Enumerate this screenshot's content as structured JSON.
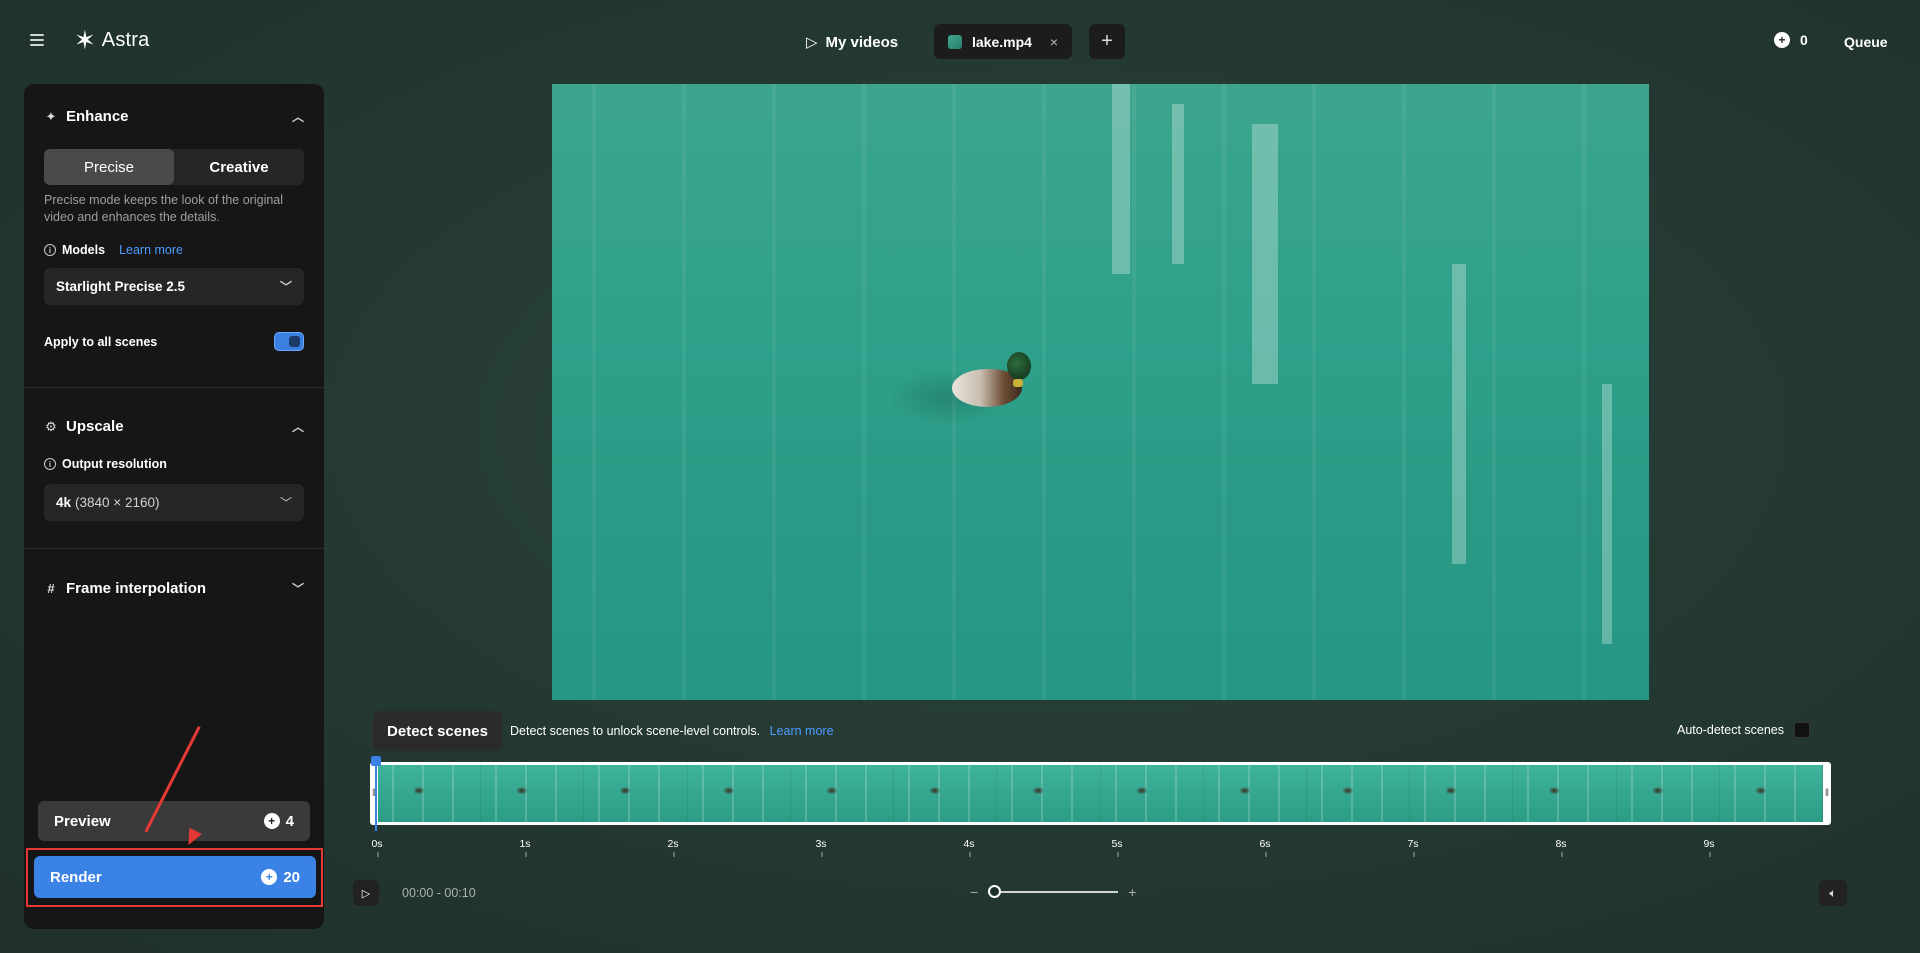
{
  "app": {
    "name": "Astra"
  },
  "header": {
    "my_videos_label": "My videos",
    "tab_file_label": "lake.mp4",
    "tab_close": "×",
    "add_tab": "+",
    "credits": "0",
    "queue_label": "Queue"
  },
  "sidebar": {
    "enhance": {
      "title": "Enhance",
      "modes": [
        "Precise",
        "Creative"
      ],
      "active_mode": "Precise",
      "description": "Precise mode keeps the look of the original video and enhances the details.",
      "models_label": "Models",
      "learn_more": "Learn more",
      "model_selected": "Starlight Precise 2.5",
      "apply_all_label": "Apply to all scenes",
      "apply_all_enabled": true
    },
    "upscale": {
      "title": "Upscale",
      "output_label": "Output resolution",
      "resolution_bold": "4k",
      "resolution_detail": "(3840 × 2160)"
    },
    "frame_interpolation": {
      "title": "Frame interpolation"
    },
    "preview": {
      "label": "Preview",
      "credits": "4"
    },
    "render": {
      "label": "Render",
      "credits": "20"
    }
  },
  "scenes": {
    "detect_label": "Detect scenes",
    "hint": "Detect scenes to unlock scene-level controls.",
    "learn_more": "Learn more",
    "auto_detect_label": "Auto-detect scenes",
    "auto_detect_checked": false
  },
  "timeline": {
    "ticks": [
      "0s",
      "1s",
      "2s",
      "3s",
      "4s",
      "5s",
      "6s",
      "7s",
      "8s",
      "9s"
    ],
    "timecode": "00:00 - 00:10",
    "zoom_minus": "−",
    "zoom_plus": "+"
  },
  "colors": {
    "accent": "#3b82e6",
    "highlight": "#e53935"
  }
}
